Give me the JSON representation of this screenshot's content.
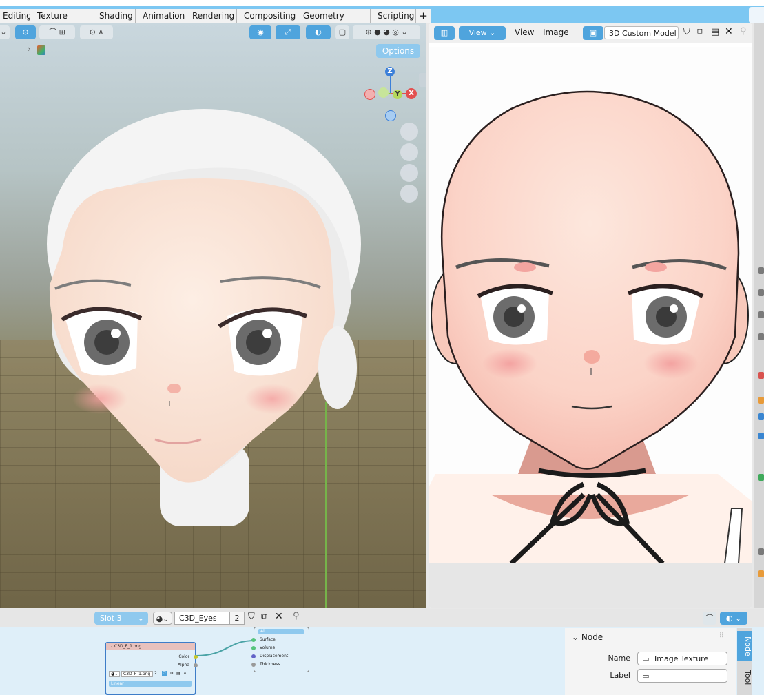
{
  "workspace": {
    "tabs": [
      "Editing",
      "Texture Paint",
      "Shading",
      "Animation",
      "Rendering",
      "Compositing",
      "Geometry Nodes",
      "Scripting"
    ],
    "add_label": "+"
  },
  "viewport": {
    "options_label": "Options",
    "gizmo": {
      "z": "Z",
      "y": "Y",
      "x": "X"
    }
  },
  "image_editor": {
    "view_label": "View",
    "menus": [
      "View",
      "Image"
    ],
    "image_name": "3D Custom Model"
  },
  "node_editor": {
    "slot": "Slot 3",
    "material_name": "C3D_Eyes",
    "material_users": "2",
    "image_node": {
      "title": "C3D_F_1.png",
      "out_color": "Color",
      "out_alpha": "Alpha",
      "image": "C3D_F_1.png",
      "users": "2",
      "interp": "Linear"
    },
    "output_node": {
      "target": "All",
      "inputs": [
        "Surface",
        "Volume",
        "Displacement",
        "Thickness"
      ]
    },
    "panel": {
      "title": "Node",
      "name_label": "Name",
      "name_value": "Image Texture",
      "label_label": "Label",
      "label_value": ""
    },
    "tabs": [
      "Node",
      "Tool"
    ]
  }
}
